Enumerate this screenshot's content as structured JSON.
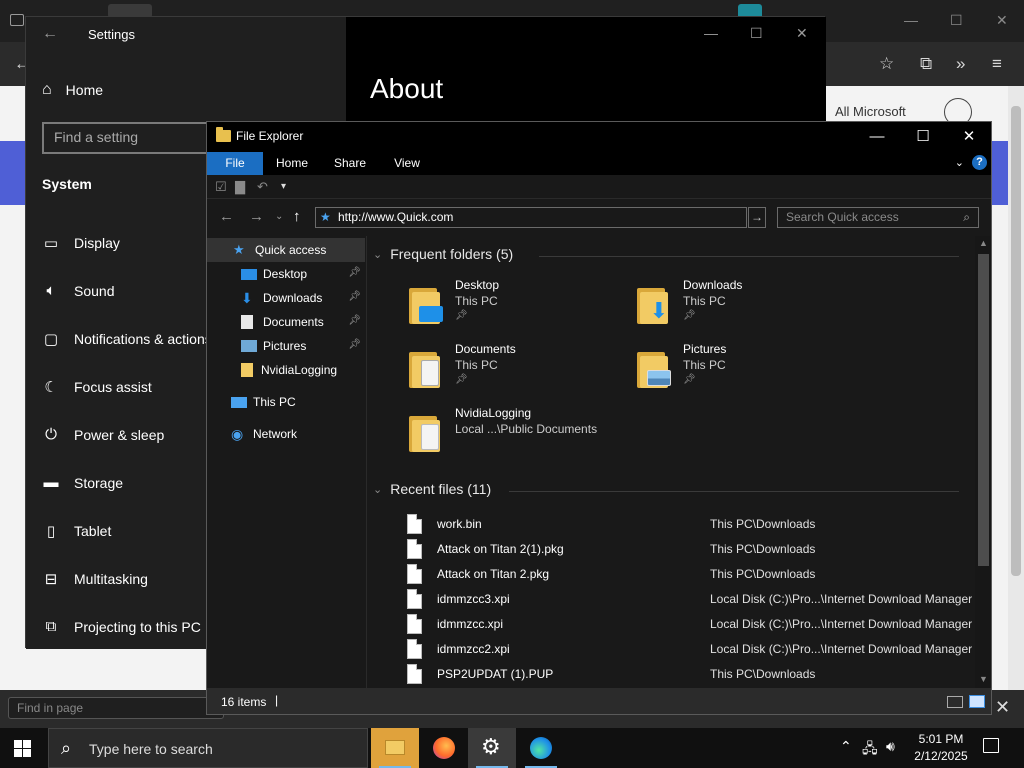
{
  "browser": {
    "all_microsoft": "All Microsoft",
    "find_placeholder": "Find in page"
  },
  "settings": {
    "window_title": "Settings",
    "home": "Home",
    "search_placeholder": "Find a setting",
    "section": "System",
    "items": [
      {
        "label": "Display",
        "icon": "display-icon"
      },
      {
        "label": "Sound",
        "icon": "sound-icon"
      },
      {
        "label": "Notifications & actions",
        "icon": "notifications-icon"
      },
      {
        "label": "Focus assist",
        "icon": "moon-icon"
      },
      {
        "label": "Power & sleep",
        "icon": "power-icon"
      },
      {
        "label": "Storage",
        "icon": "storage-icon"
      },
      {
        "label": "Tablet",
        "icon": "tablet-icon"
      },
      {
        "label": "Multitasking",
        "icon": "multitasking-icon"
      },
      {
        "label": "Projecting to this PC",
        "icon": "projecting-icon"
      }
    ],
    "page_title": "About"
  },
  "explorer": {
    "window_title": "File Explorer",
    "ribbon_tabs": [
      "File",
      "Home",
      "Share",
      "View"
    ],
    "address": "http://www.Quick.com",
    "search_placeholder": "Search Quick access",
    "nav": {
      "quick_access": "Quick access",
      "pinned": [
        "Desktop",
        "Downloads",
        "Documents",
        "Pictures"
      ],
      "unpinned": [
        "NvidiaLogging"
      ],
      "this_pc": "This PC",
      "network": "Network"
    },
    "frequent_header": "Frequent folders (5)",
    "frequent": [
      {
        "name": "Desktop",
        "location": "This PC",
        "pinned": true
      },
      {
        "name": "Downloads",
        "location": "This PC",
        "pinned": true
      },
      {
        "name": "Documents",
        "location": "This PC",
        "pinned": true
      },
      {
        "name": "Pictures",
        "location": "This PC",
        "pinned": true
      },
      {
        "name": "NvidiaLogging",
        "location": "Local ...\\Public Documents",
        "pinned": false
      }
    ],
    "recent_header": "Recent files (11)",
    "recent": [
      {
        "name": "work.bin",
        "location": "This PC\\Downloads"
      },
      {
        "name": "Attack on Titan 2(1).pkg",
        "location": "This PC\\Downloads"
      },
      {
        "name": "Attack on Titan 2.pkg",
        "location": "This PC\\Downloads"
      },
      {
        "name": "idmmzcc3.xpi",
        "location": "Local Disk (C:)\\Pro...\\Internet Download Manager"
      },
      {
        "name": "idmmzcc.xpi",
        "location": "Local Disk (C:)\\Pro...\\Internet Download Manager"
      },
      {
        "name": "idmmzcc2.xpi",
        "location": "Local Disk (C:)\\Pro...\\Internet Download Manager"
      },
      {
        "name": "PSP2UPDAT (1).PUP",
        "location": "This PC\\Downloads"
      }
    ],
    "status": "16 items"
  },
  "taskbar": {
    "search_placeholder": "Type here to search",
    "time": "5:01 PM",
    "date": "2/12/2025"
  }
}
